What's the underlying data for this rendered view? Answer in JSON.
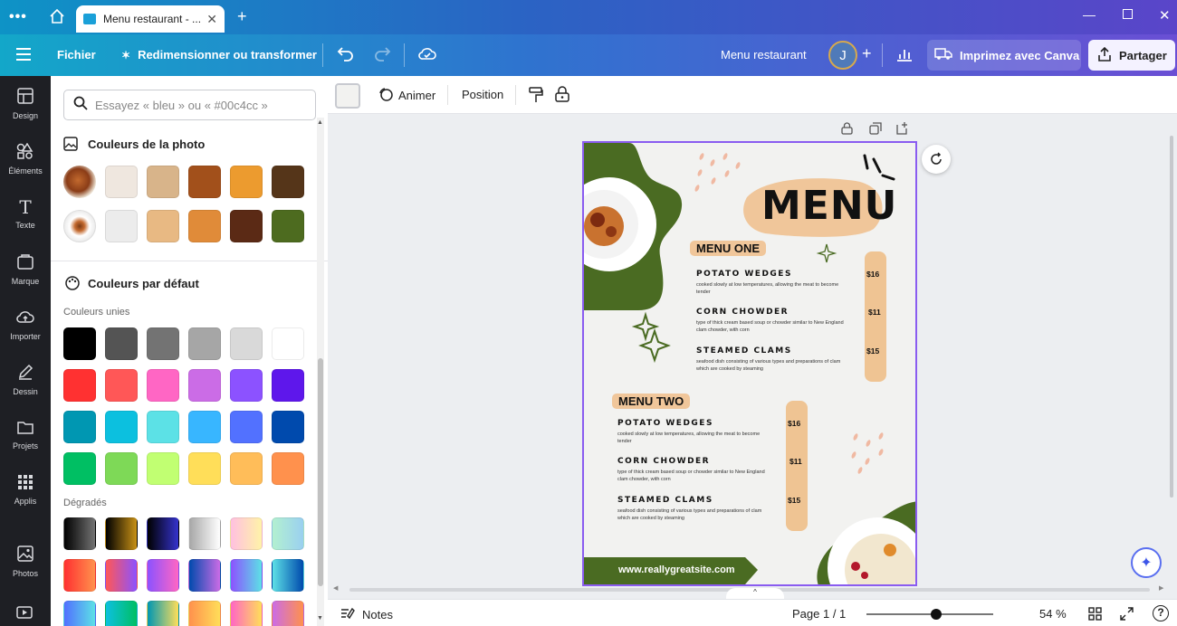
{
  "window": {
    "tab_title": "Menu restaurant - ...",
    "new_tab_icon": "plus-icon"
  },
  "toolbar": {
    "file_label": "Fichier",
    "resize_label": "Redimensionner ou transformer",
    "design_name": "Menu restaurant",
    "avatar_initial": "J",
    "print_label": "Imprimez avec Canva",
    "share_label": "Partager"
  },
  "rail": [
    {
      "label": "Design"
    },
    {
      "label": "Éléments"
    },
    {
      "label": "Texte"
    },
    {
      "label": "Marque"
    },
    {
      "label": "Importer"
    },
    {
      "label": "Dessin"
    },
    {
      "label": "Projets"
    },
    {
      "label": "Applis"
    },
    {
      "label": "Photos"
    }
  ],
  "panel": {
    "search_placeholder": "Essayez « bleu » ou « #00c4cc »",
    "photo_colors_title": "Couleurs de la photo",
    "photo_colors_row1": [
      "#efe7df",
      "#d8b48a",
      "#a2501b",
      "#ec9b2f",
      "#553519"
    ],
    "photo_colors_row2": [
      "#ececec",
      "#e8b983",
      "#e08b39",
      "#5b2a15",
      "#4d6b1f"
    ],
    "default_colors_title": "Couleurs par défaut",
    "solid_colors_label": "Couleurs unies",
    "solid_colors": [
      "#000000",
      "#545454",
      "#737373",
      "#a6a6a6",
      "#d9d9d9",
      "#ffffff",
      "#ff3131",
      "#ff5757",
      "#ff66c4",
      "#cb6ce6",
      "#8c52ff",
      "#5e17eb",
      "#0097b2",
      "#0cc0df",
      "#5ce1e6",
      "#38b6ff",
      "#5271ff",
      "#004aad",
      "#00bf63",
      "#7ed957",
      "#c1ff72",
      "#ffde59",
      "#ffbd59",
      "#ff914d"
    ],
    "gradients_label": "Dégradés"
  },
  "context_bar": {
    "animate_label": "Animer",
    "position_label": "Position"
  },
  "menu": {
    "title": "MENU",
    "section1": "MENU ONE",
    "section2": "MENU TWO",
    "items1": [
      {
        "name": "POTATO WEDGES",
        "desc": "cooked slowly at low temperatures, allowing the meat to become tender",
        "price": "$16"
      },
      {
        "name": "CORN CHOWDER",
        "desc": "type of thick cream based soup or chowder similar to New England clam chowder, with corn",
        "price": "$11"
      },
      {
        "name": "STEAMED CLAMS",
        "desc": "seafood dish consisting of various types and preparations of clam which are cooked by steaming",
        "price": "$15"
      }
    ],
    "items2": [
      {
        "name": "POTATO WEDGES",
        "desc": "cooked slowly at low temperatures, allowing the meat to become tender",
        "price": "$16"
      },
      {
        "name": "CORN CHOWDER",
        "desc": "type of thick cream based soup or chowder similar to New England clam chowder, with corn",
        "price": "$11"
      },
      {
        "name": "STEAMED CLAMS",
        "desc": "seafood dish consisting of various types and preparations of clam which are cooked by steaming",
        "price": "$15"
      }
    ],
    "website": "www.reallygreatsite.com"
  },
  "footer": {
    "notes_label": "Notes",
    "page_label": "Page 1 / 1",
    "zoom_label": "54 %",
    "zoom_value_percent": 54
  }
}
